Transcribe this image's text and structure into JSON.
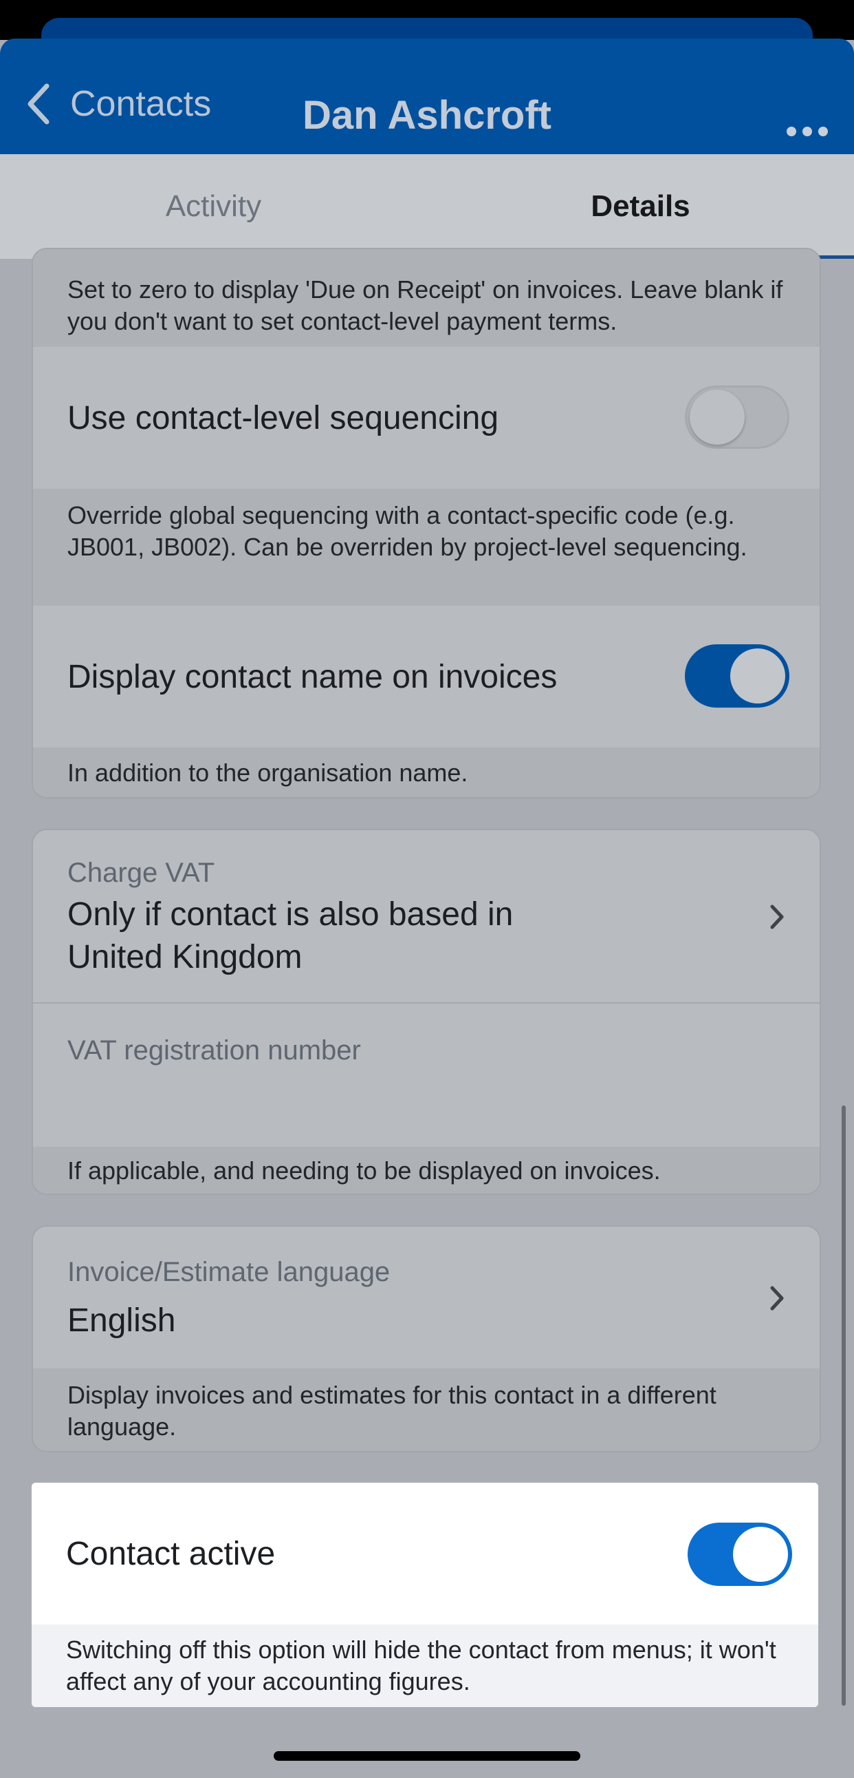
{
  "nav": {
    "back_label": "Contacts",
    "title": "Dan Ashcroft",
    "more_icon": "ellipsis-icon",
    "back_icon": "chevron-left-icon"
  },
  "tabs": [
    {
      "label": "Activity",
      "selected": false
    },
    {
      "label": "Details",
      "selected": true
    }
  ],
  "payment_terms_help": "Set to zero to display 'Due on Receipt' on invoices. Leave blank if you don't want to set contact-level payment terms.",
  "sequencing": {
    "label": "Use contact-level sequencing",
    "enabled": false,
    "help": "Override global sequencing with a contact-specific code (e.g. JB001, JB002). Can be overriden by project-level sequencing."
  },
  "display_name": {
    "label": "Display contact name on invoices",
    "enabled": true,
    "help": "In addition to the organisation name."
  },
  "vat": {
    "charge_label": "Charge VAT",
    "charge_value": "Only if contact is also based in United Kingdom",
    "reg_label": "VAT registration number",
    "reg_value": "",
    "help": "If applicable, and needing to be displayed on invoices."
  },
  "language": {
    "label": "Invoice/Estimate language",
    "value": "English",
    "help": "Display invoices and estimates for this contact in a different language."
  },
  "contact_active": {
    "label": "Contact active",
    "enabled": true,
    "help": "Switching off this option will hide the contact from menus; it won't affect any of your accounting figures."
  },
  "colors": {
    "brand": "#00509e",
    "toggle_on": "#0a6fd1"
  }
}
